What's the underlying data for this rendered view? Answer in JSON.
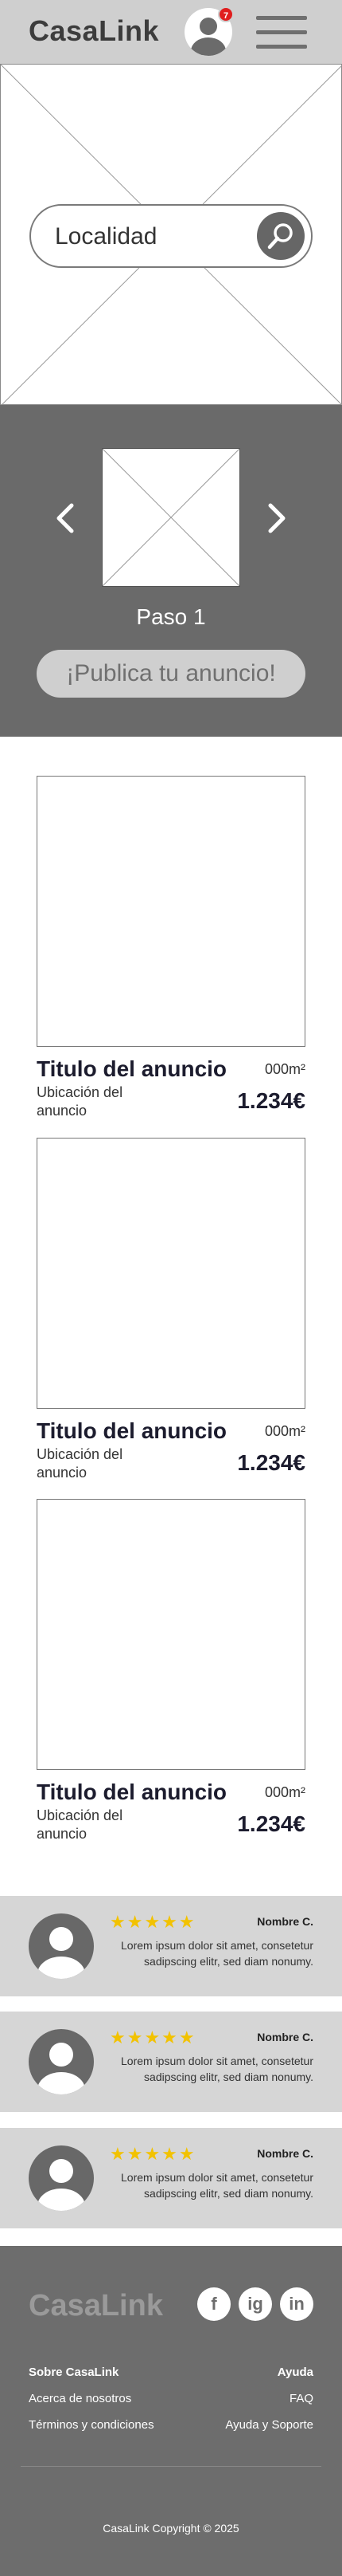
{
  "header": {
    "logo": "CasaLink",
    "notification_count": "7"
  },
  "hero": {
    "search_placeholder": "Localidad"
  },
  "steps": {
    "label": "Paso 1",
    "publish_button": "¡Publica tu anuncio!"
  },
  "listings": [
    {
      "title": "Titulo del anuncio",
      "area": "000m²",
      "location": "Ubicación del anuncio",
      "price": "1.234€"
    },
    {
      "title": "Titulo del anuncio",
      "area": "000m²",
      "location": "Ubicación del anuncio",
      "price": "1.234€"
    },
    {
      "title": "Titulo del anuncio",
      "area": "000m²",
      "location": "Ubicación del anuncio",
      "price": "1.234€"
    }
  ],
  "reviews": [
    {
      "stars": "★★★★★",
      "rating": 5,
      "name": "Nombre C.",
      "text": "Lorem ipsum dolor sit amet, consetetur sadipscing elitr, sed diam nonumy."
    },
    {
      "stars": "★★★★★",
      "rating": 5,
      "name": "Nombre C.",
      "text": "Lorem ipsum dolor sit amet, consetetur sadipscing elitr, sed diam nonumy."
    },
    {
      "stars": "★★★★★",
      "rating": 5,
      "name": "Nombre C.",
      "text": "Lorem ipsum dolor sit amet, consetetur sadipscing elitr, sed diam nonumy."
    }
  ],
  "footer": {
    "logo": "CasaLink",
    "social": {
      "facebook": "f",
      "instagram": "ig",
      "linkedin": "in"
    },
    "links_left": [
      "Sobre CasaLink",
      "Acerca de nosotros",
      "Términos y condiciones"
    ],
    "links_right": [
      "Ayuda",
      "FAQ",
      "Ayuda y Soporte"
    ],
    "copyright": "CasaLink Copyright © 2025"
  },
  "colors": {
    "header_bg": "#cfcfcf",
    "dark_section_bg": "#6a6a6a",
    "badge": "#e01d1d",
    "stars": "#f2c200",
    "review_bg": "#d6d6d6"
  }
}
